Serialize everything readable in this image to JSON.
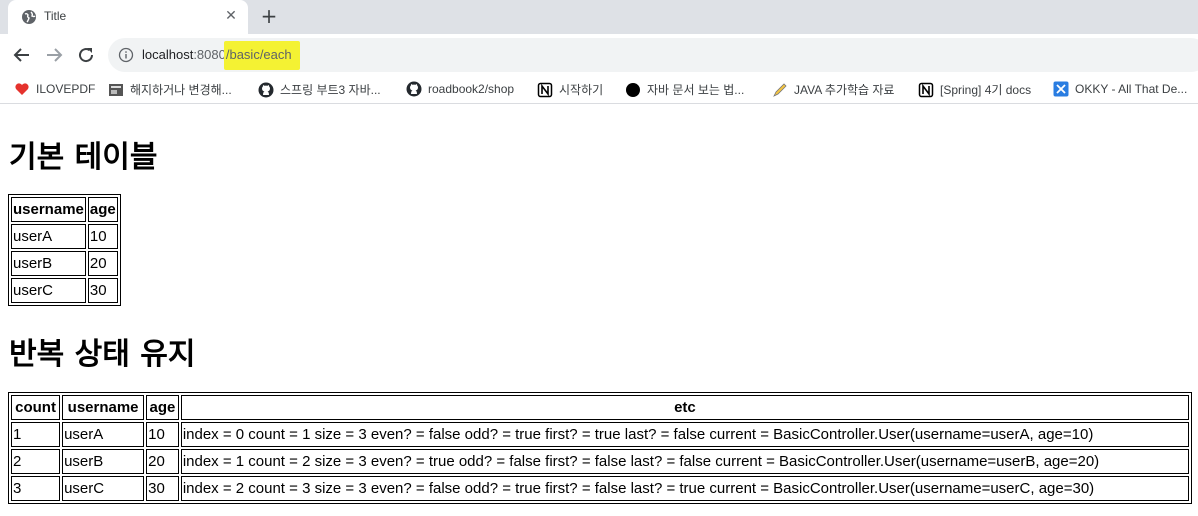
{
  "browser": {
    "tab_title": "Title",
    "url_host": "localhost",
    "url_port": ":8080",
    "url_path": "/basic/each",
    "highlight_color": "#f4f233"
  },
  "bookmarks": [
    {
      "label": "ILOVEPDF",
      "icon": "heart-icon"
    },
    {
      "label": "해지하거나 변경해...",
      "icon": "page-icon"
    },
    {
      "label": "스프링 부트3 자바...",
      "icon": "github-icon"
    },
    {
      "label": "roadbook2/shop",
      "icon": "github-icon"
    },
    {
      "label": "시작하기",
      "icon": "notion-icon"
    },
    {
      "label": "자바 문서 보는 법...",
      "icon": "black-circle-icon"
    },
    {
      "label": "JAVA 추가학습 자료",
      "icon": "pen-icon"
    },
    {
      "label": "[Spring] 4기 docs",
      "icon": "notion-icon"
    },
    {
      "label": "OKKY - All That De...",
      "icon": "okky-icon"
    }
  ],
  "section1": {
    "title": "기본 테이블",
    "headers": [
      "username",
      "age"
    ],
    "rows": [
      [
        "userA",
        "10"
      ],
      [
        "userB",
        "20"
      ],
      [
        "userC",
        "30"
      ]
    ]
  },
  "section2": {
    "title": "반복 상태 유지",
    "headers": [
      "count",
      "username",
      "age",
      "etc"
    ],
    "rows": [
      [
        "1",
        "userA",
        "10",
        "index = 0 count = 1 size = 3 even? = false odd? = true first? = true last? = false current = BasicController.User(username=userA, age=10)"
      ],
      [
        "2",
        "userB",
        "20",
        "index = 1 count = 2 size = 3 even? = true odd? = false first? = false last? = false current = BasicController.User(username=userB, age=20)"
      ],
      [
        "3",
        "userC",
        "30",
        "index = 2 count = 3 size = 3 even? = false odd? = true first? = false last? = true current = BasicController.User(username=userC, age=30)"
      ]
    ]
  }
}
